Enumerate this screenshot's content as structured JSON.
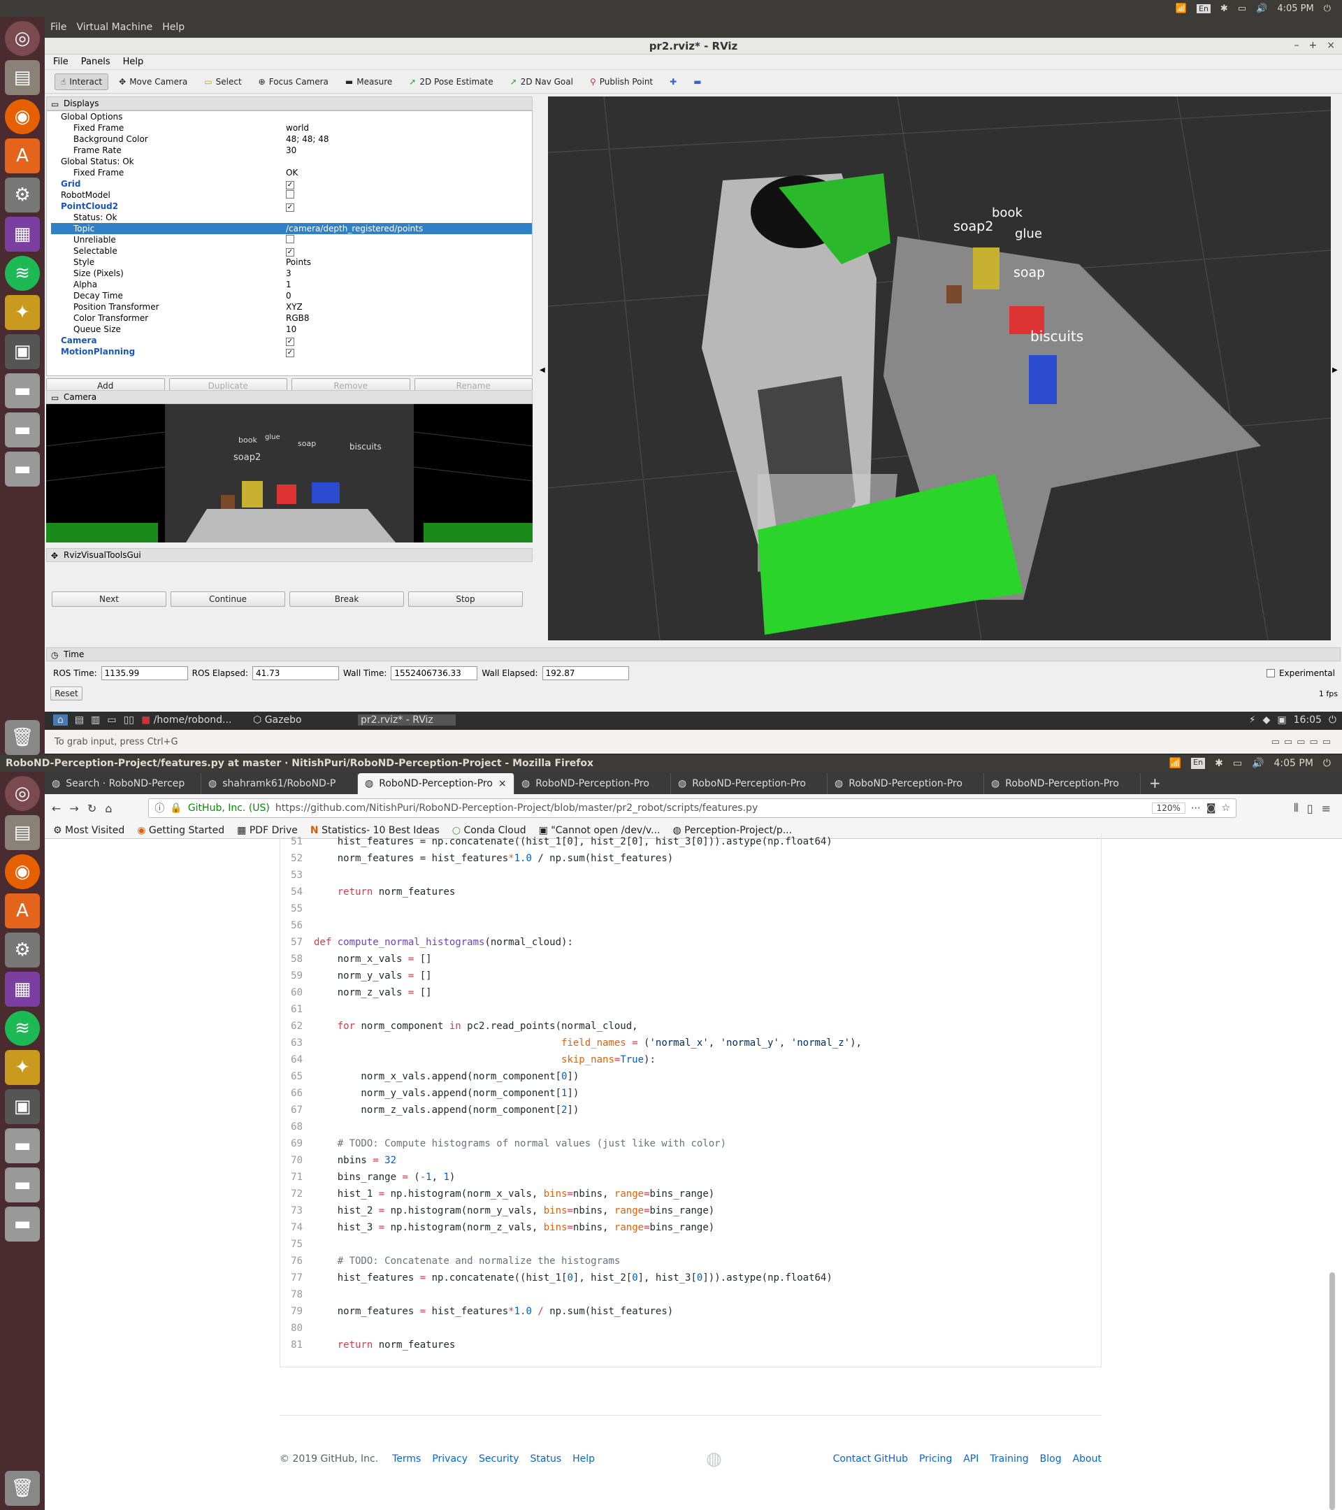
{
  "system": {
    "clock": "4:05 PM",
    "lang": "En"
  },
  "vm_menu": [
    "File",
    "Virtual Machine",
    "Help"
  ],
  "rviz": {
    "title": "pr2.rviz* - RViz",
    "menu": [
      "File",
      "Panels",
      "Help"
    ],
    "tools": [
      {
        "label": "Interact",
        "icon": "interact-icon"
      },
      {
        "label": "Move Camera",
        "icon": "move-camera-icon"
      },
      {
        "label": "Select",
        "icon": "select-icon"
      },
      {
        "label": "Focus Camera",
        "icon": "focus-camera-icon"
      },
      {
        "label": "Measure",
        "icon": "measure-icon"
      },
      {
        "label": "2D Pose Estimate",
        "icon": "pose-arrow-icon"
      },
      {
        "label": "2D Nav Goal",
        "icon": "nav-arrow-icon"
      },
      {
        "label": "Publish Point",
        "icon": "map-pin-icon"
      }
    ],
    "displays_title": "Displays",
    "displays": [
      {
        "k": "Global Options",
        "v": ""
      },
      {
        "k": "Fixed Frame",
        "v": "world"
      },
      {
        "k": "Background Color",
        "v": "48; 48; 48"
      },
      {
        "k": "Frame Rate",
        "v": "30"
      },
      {
        "k": "Global Status: Ok",
        "v": ""
      },
      {
        "k": "Fixed Frame",
        "v": "OK"
      },
      {
        "k": "Grid",
        "v": ""
      },
      {
        "k": "RobotModel",
        "v": ""
      },
      {
        "k": "PointCloud2",
        "v": ""
      },
      {
        "k": "Status: Ok",
        "v": ""
      },
      {
        "k": "Topic",
        "v": "/camera/depth_registered/points"
      },
      {
        "k": "Unreliable",
        "v": ""
      },
      {
        "k": "Selectable",
        "v": ""
      },
      {
        "k": "Style",
        "v": "Points"
      },
      {
        "k": "Size (Pixels)",
        "v": "3"
      },
      {
        "k": "Alpha",
        "v": "1"
      },
      {
        "k": "Decay Time",
        "v": "0"
      },
      {
        "k": "Position Transformer",
        "v": "XYZ"
      },
      {
        "k": "Color Transformer",
        "v": "RGB8"
      },
      {
        "k": "Queue Size",
        "v": "10"
      },
      {
        "k": "Camera",
        "v": ""
      },
      {
        "k": "MotionPlanning",
        "v": ""
      }
    ],
    "display_buttons": [
      "Add",
      "Duplicate",
      "Remove",
      "Rename"
    ],
    "camera_title": "Camera",
    "camera_labels": [
      "book",
      "glue",
      "soap",
      "soap2",
      "biscuits"
    ],
    "tools_gui_title": "RvizVisualToolsGui",
    "tools_gui_buttons": [
      "Next",
      "Continue",
      "Break",
      "Stop"
    ],
    "scene_labels": [
      "soap2",
      "book",
      "glue",
      "soap",
      "biscuits"
    ],
    "time_title": "Time",
    "time": {
      "ros_time_label": "ROS Time:",
      "ros_time": "1135.99",
      "ros_elapsed_label": "ROS Elapsed:",
      "ros_elapsed": "41.73",
      "wall_time_label": "Wall Time:",
      "wall_time": "1552406736.33",
      "wall_elapsed_label": "Wall Elapsed:",
      "wall_elapsed": "192.87",
      "experimental": "Experimental",
      "reset": "Reset",
      "fps": "1 fps"
    }
  },
  "lxpanel": {
    "tasks": [
      "/home/robond...",
      "Gazebo",
      "pr2.rviz* - RViz"
    ],
    "clock": "16:05"
  },
  "vm_status": "To grab input, press Ctrl+G",
  "firefox": {
    "title": "RoboND-Perception-Project/features.py at master · NitishPuri/RoboND-Perception-Project - Mozilla Firefox",
    "tabs": [
      "Search · RoboND-Percep",
      "shahramk61/RoboND-P",
      "RoboND-Perception-Pro",
      "RoboND-Perception-Pro",
      "RoboND-Perception-Pro",
      "RoboND-Perception-Pro",
      "RoboND-Perception-Pro"
    ],
    "identity": "GitHub, Inc. (US)",
    "url": "https://github.com/NitishPuri/RoboND-Perception-Project/blob/master/pr2_robot/scripts/features.py",
    "zoom": "120%",
    "bookmarks": [
      "Most Visited",
      "Getting Started",
      "PDF Drive",
      "Statistics- 10 Best Ideas",
      "Conda Cloud",
      "\"Cannot open /dev/v...",
      "Perception-Project/p..."
    ]
  },
  "code_lines": [
    {
      "n": "51",
      "html": "    hist_features = np.concatenate((hist_1[0], hist_2[0], hist_3[0])).astype(np.float64)"
    },
    {
      "n": "52",
      "html": "    norm_features = hist_features<span class=\"pr\">*</span><span class=\"nm\">1.0</span> / np.sum(hist_features)"
    },
    {
      "n": "53",
      "html": ""
    },
    {
      "n": "54",
      "html": "    <span class=\"kw\">return</span> norm_features"
    },
    {
      "n": "55",
      "html": ""
    },
    {
      "n": "56",
      "html": ""
    },
    {
      "n": "57",
      "html": "<span class=\"kw\">def</span> <span class=\"fn\">compute_normal_histograms</span>(normal_cloud):"
    },
    {
      "n": "58",
      "html": "    norm_x_vals <span class=\"kw\">=</span> []"
    },
    {
      "n": "59",
      "html": "    norm_y_vals <span class=\"kw\">=</span> []"
    },
    {
      "n": "60",
      "html": "    norm_z_vals <span class=\"kw\">=</span> []"
    },
    {
      "n": "61",
      "html": ""
    },
    {
      "n": "62",
      "html": "    <span class=\"kw\">for</span> norm_component <span class=\"kw\">in</span> pc2.read_points(normal_cloud,"
    },
    {
      "n": "63",
      "html": "                                          <span class=\"pr\">field_names</span> <span class=\"kw\">=</span> (<span class=\"st\">'normal_x'</span>, <span class=\"st\">'normal_y'</span>, <span class=\"st\">'normal_z'</span>),"
    },
    {
      "n": "64",
      "html": "                                          <span class=\"pr\">skip_nans</span><span class=\"kw\">=</span><span class=\"nm\">True</span>):"
    },
    {
      "n": "65",
      "html": "        norm_x_vals.append(norm_component[<span class=\"nm\">0</span>])"
    },
    {
      "n": "66",
      "html": "        norm_y_vals.append(norm_component[<span class=\"nm\">1</span>])"
    },
    {
      "n": "67",
      "html": "        norm_z_vals.append(norm_component[<span class=\"nm\">2</span>])"
    },
    {
      "n": "68",
      "html": ""
    },
    {
      "n": "69",
      "html": "    <span class=\"cm\"># TODO: Compute histograms of normal values (just like with color)</span>"
    },
    {
      "n": "70",
      "html": "    nbins <span class=\"kw\">=</span> <span class=\"nm\">32</span>"
    },
    {
      "n": "71",
      "html": "    bins_range <span class=\"kw\">=</span> (<span class=\"kw\">-</span><span class=\"nm\">1</span>, <span class=\"nm\">1</span>)"
    },
    {
      "n": "72",
      "html": "    hist_1 <span class=\"kw\">=</span> np.histogram(norm_x_vals, <span class=\"pr\">bins</span><span class=\"kw\">=</span>nbins, <span class=\"pr\">range</span><span class=\"kw\">=</span>bins_range)"
    },
    {
      "n": "73",
      "html": "    hist_2 <span class=\"kw\">=</span> np.histogram(norm_y_vals, <span class=\"pr\">bins</span><span class=\"kw\">=</span>nbins, <span class=\"pr\">range</span><span class=\"kw\">=</span>bins_range)"
    },
    {
      "n": "74",
      "html": "    hist_3 <span class=\"kw\">=</span> np.histogram(norm_z_vals, <span class=\"pr\">bins</span><span class=\"kw\">=</span>nbins, <span class=\"pr\">range</span><span class=\"kw\">=</span>bins_range)"
    },
    {
      "n": "75",
      "html": ""
    },
    {
      "n": "76",
      "html": "    <span class=\"cm\"># TODO: Concatenate and normalize the histograms</span>"
    },
    {
      "n": "77",
      "html": "    hist_features <span class=\"kw\">=</span> np.concatenate((hist_1[<span class=\"nm\">0</span>], hist_2[<span class=\"nm\">0</span>], hist_3[<span class=\"nm\">0</span>])).astype(np.float64)"
    },
    {
      "n": "78",
      "html": ""
    },
    {
      "n": "79",
      "html": "    norm_features <span class=\"kw\">=</span> hist_features<span class=\"kw\">*</span><span class=\"nm\">1.0</span> <span class=\"kw\">/</span> np.sum(hist_features)"
    },
    {
      "n": "80",
      "html": ""
    },
    {
      "n": "81",
      "html": "    <span class=\"kw\">return</span> norm_features"
    }
  ],
  "footer": {
    "copyright": "© 2019 GitHub, Inc.",
    "left_links": [
      "Terms",
      "Privacy",
      "Security",
      "Status",
      "Help"
    ],
    "right_links": [
      "Contact GitHub",
      "Pricing",
      "API",
      "Training",
      "Blog",
      "About"
    ]
  }
}
